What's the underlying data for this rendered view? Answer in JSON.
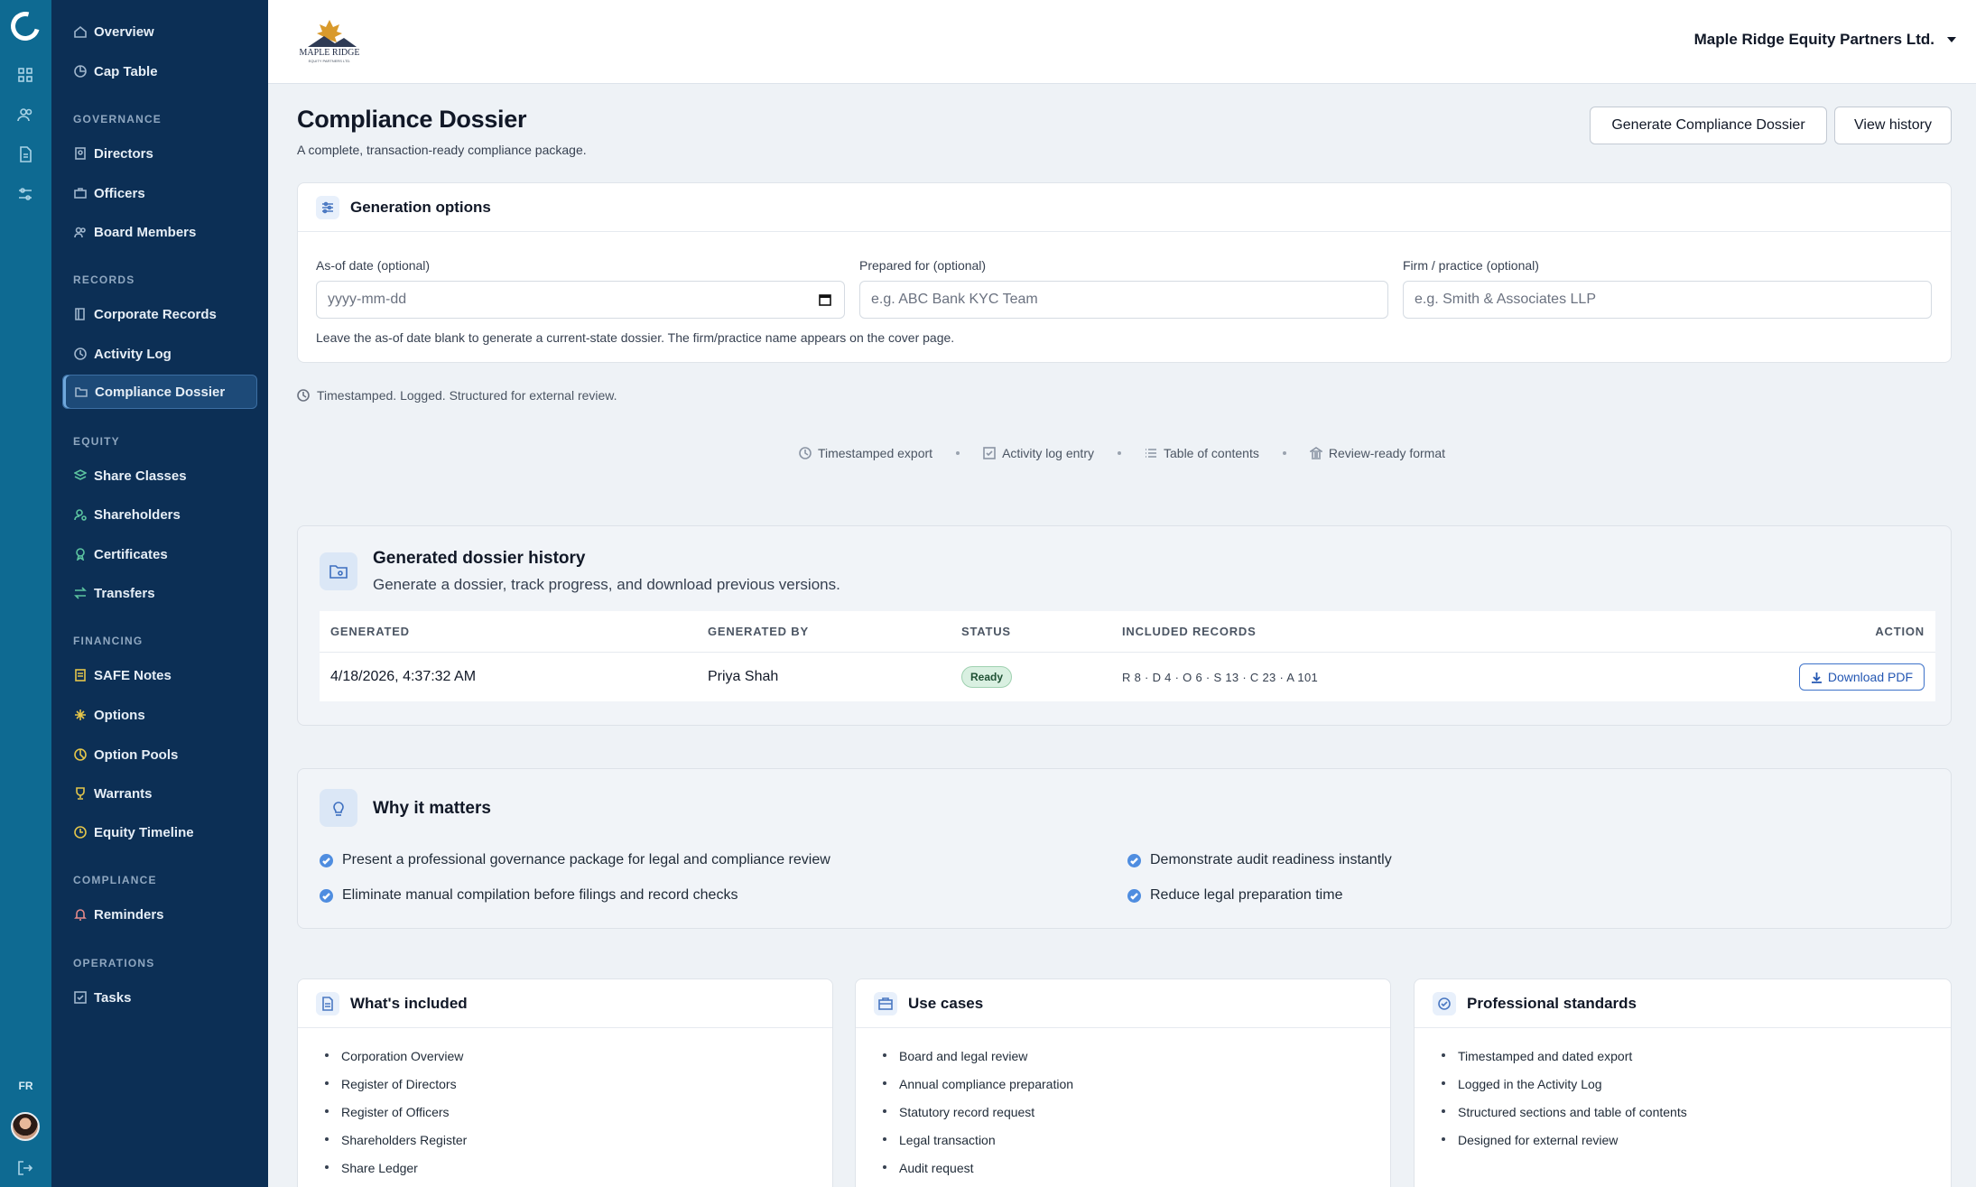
{
  "topbar": {
    "company_name": "Maple Ridge Equity Partners Ltd.",
    "logo_text": "MAPLE RIDGE",
    "logo_subtext": "EQUITY PARTNERS LTD."
  },
  "rail": {
    "language": "FR"
  },
  "sidebar": {
    "top_items": [
      {
        "label": "Overview",
        "icon": "home-icon"
      },
      {
        "label": "Cap Table",
        "icon": "pie-chart-icon"
      }
    ],
    "sections": [
      {
        "title": "GOVERNANCE",
        "items": [
          {
            "label": "Directors",
            "icon": "badge-icon"
          },
          {
            "label": "Officers",
            "icon": "briefcase-icon"
          },
          {
            "label": "Board Members",
            "icon": "users-icon"
          }
        ]
      },
      {
        "title": "RECORDS",
        "items": [
          {
            "label": "Corporate Records",
            "icon": "book-icon"
          },
          {
            "label": "Activity Log",
            "icon": "clock-icon"
          },
          {
            "label": "Compliance Dossier",
            "icon": "folder-icon"
          }
        ]
      },
      {
        "title": "EQUITY",
        "items": [
          {
            "label": "Share Classes",
            "icon": "layers-icon"
          },
          {
            "label": "Shareholders",
            "icon": "shareholder-icon"
          },
          {
            "label": "Certificates",
            "icon": "award-icon"
          },
          {
            "label": "Transfers",
            "icon": "transfer-icon"
          }
        ]
      },
      {
        "title": "FINANCING",
        "items": [
          {
            "label": "SAFE Notes",
            "icon": "note-icon"
          },
          {
            "label": "Options",
            "icon": "sparkle-icon"
          },
          {
            "label": "Option Pools",
            "icon": "pool-icon"
          },
          {
            "label": "Warrants",
            "icon": "trophy-icon"
          },
          {
            "label": "Equity Timeline",
            "icon": "timeline-icon"
          }
        ]
      },
      {
        "title": "COMPLIANCE",
        "items": [
          {
            "label": "Reminders",
            "icon": "bell-icon"
          }
        ]
      },
      {
        "title": "OPERATIONS",
        "items": [
          {
            "label": "Tasks",
            "icon": "checkbox-icon"
          }
        ]
      }
    ]
  },
  "page": {
    "title": "Compliance Dossier",
    "subtitle": "A complete, transaction-ready compliance package.",
    "generate_button": "Generate Compliance Dossier",
    "history_button": "View history"
  },
  "options": {
    "title": "Generation options",
    "as_of_label": "As-of date (optional)",
    "as_of_placeholder": "yyyy-mm-dd",
    "prepared_for_label": "Prepared for (optional)",
    "prepared_for_placeholder": "e.g. ABC Bank KYC Team",
    "firm_label": "Firm / practice (optional)",
    "firm_placeholder": "e.g. Smith & Associates LLP",
    "hint": "Leave the as-of date blank to generate a current-state dossier. The firm/practice name appears on the cover page."
  },
  "stamp_line": "Timestamped. Logged. Structured for external review.",
  "features": [
    {
      "label": "Timestamped export",
      "icon": "clock-icon"
    },
    {
      "label": "Activity log entry",
      "icon": "checkbox-icon"
    },
    {
      "label": "Table of contents",
      "icon": "list-icon"
    },
    {
      "label": "Review-ready format",
      "icon": "bank-icon"
    }
  ],
  "history": {
    "title": "Generated dossier history",
    "subtitle": "Generate a dossier, track progress, and download previous versions.",
    "columns": [
      "GENERATED",
      "GENERATED BY",
      "STATUS",
      "INCLUDED RECORDS",
      "ACTION"
    ],
    "rows": [
      {
        "generated": "4/18/2026, 4:37:32 AM",
        "by": "Priya Shah",
        "status": "Ready",
        "records": "R 8 · D 4 · O 6 · S 13 · C 23 · A 101",
        "action": "Download PDF"
      }
    ]
  },
  "why": {
    "title": "Why it matters",
    "items": [
      "Present a professional governance package for legal and compliance review",
      "Demonstrate audit readiness instantly",
      "Eliminate manual compilation before filings and record checks",
      "Reduce legal preparation time"
    ]
  },
  "included": {
    "title": "What's included",
    "items": [
      "Corporation Overview",
      "Register of Directors",
      "Register of Officers",
      "Shareholders Register",
      "Share Ledger"
    ]
  },
  "use_cases": {
    "title": "Use cases",
    "items": [
      "Board and legal review",
      "Annual compliance preparation",
      "Statutory record request",
      "Legal transaction",
      "Audit request"
    ]
  },
  "standards": {
    "title": "Professional standards",
    "items": [
      "Timestamped and dated export",
      "Logged in the Activity Log",
      "Structured sections and table of contents",
      "Designed for external review"
    ]
  },
  "colors": {
    "rail": "#0e6a92",
    "sidebar": "#0c2f55",
    "accent": "#4f8de0",
    "ready_badge": "#d9f0e1"
  }
}
